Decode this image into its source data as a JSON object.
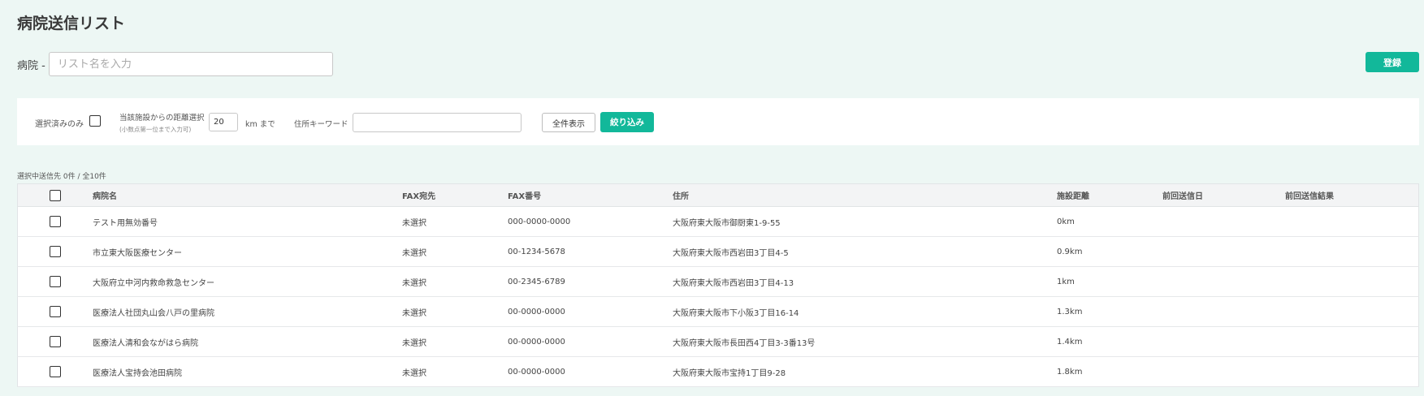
{
  "header": {
    "title": "病院送信リスト"
  },
  "list_name": {
    "label": "病院 -",
    "placeholder": "リスト名を入力",
    "value": ""
  },
  "register_button": "登録",
  "filters": {
    "selected_only_label": "選択済みのみ",
    "selected_only_checked": false,
    "distance_label": "当該施設からの距離選択",
    "distance_note": "(小数点第一位まで入力可)",
    "distance_value": "20",
    "distance_unit": "km まで",
    "address_keyword_label": "住所キーワード",
    "address_keyword_value": "",
    "show_all_button": "全件表示",
    "filter_button": "絞り込み"
  },
  "selection_summary": "選択中送信先 0件 / 全10件",
  "table": {
    "columns": [
      "病院名",
      "FAX宛先",
      "FAX番号",
      "住所",
      "施設距離",
      "前回送信日",
      "前回送信結果"
    ],
    "rows": [
      {
        "name": "テスト用無効番号",
        "fax_to": "未選択",
        "fax_no": "000-0000-0000",
        "address": "大阪府東大阪市御厨東1-9-55",
        "distance": "0km",
        "last_date": "",
        "last_result": ""
      },
      {
        "name": "市立東大阪医療センター",
        "fax_to": "未選択",
        "fax_no": "00-1234-5678",
        "address": "大阪府東大阪市西岩田3丁目4-5",
        "distance": "0.9km",
        "last_date": "",
        "last_result": ""
      },
      {
        "name": "大阪府立中河内救命救急センター",
        "fax_to": "未選択",
        "fax_no": "00-2345-6789",
        "address": "大阪府東大阪市西岩田3丁目4-13",
        "distance": "1km",
        "last_date": "",
        "last_result": ""
      },
      {
        "name": "医療法人社団丸山会八戸の里病院",
        "fax_to": "未選択",
        "fax_no": "00-0000-0000",
        "address": "大阪府東大阪市下小阪3丁目16-14",
        "distance": "1.3km",
        "last_date": "",
        "last_result": ""
      },
      {
        "name": "医療法人清和会ながはら病院",
        "fax_to": "未選択",
        "fax_no": "00-0000-0000",
        "address": "大阪府東大阪市長田西4丁目3-3番13号",
        "distance": "1.4km",
        "last_date": "",
        "last_result": ""
      },
      {
        "name": "医療法人宝持会池田病院",
        "fax_to": "未選択",
        "fax_no": "00-0000-0000",
        "address": "大阪府東大阪市宝持1丁目9-28",
        "distance": "1.8km",
        "last_date": "",
        "last_result": ""
      }
    ]
  }
}
